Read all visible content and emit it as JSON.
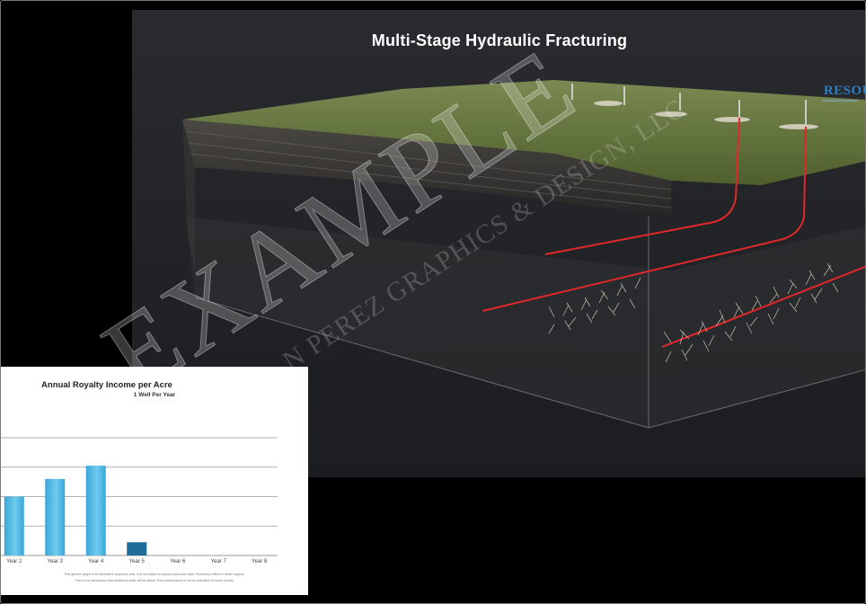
{
  "video": {
    "title": "Multi-Stage Hydraulic Fracturing",
    "brand_text": "RESOU"
  },
  "watermark": {
    "main": "EXAMPLE",
    "sub": "N PEREZ GRAPHICS & DESIGN, LLC"
  },
  "chart_data": {
    "type": "bar",
    "title": "Annual Royalty Income per Acre",
    "subtitle": "1 Well Per Year",
    "categories": [
      "Year 2",
      "Year 3",
      "Year 4",
      "Year 5",
      "Year 6",
      "Year 7",
      "Year 8"
    ],
    "values": [
      2.0,
      2.6,
      3.05,
      0.45,
      0,
      0,
      0
    ],
    "ylim": [
      0,
      4
    ],
    "grid": true,
    "notes": [
      "This generic graph is for illustrative purposes only. It is not based on actual production data. Production differs in shale regions.",
      "There is no assurance that additional wells will be drilled. Past performance is not an indication of future results."
    ],
    "colors": {
      "bar": "#3aa6d6",
      "bar_dark": "#1f6d98",
      "grid": "#999999"
    }
  }
}
